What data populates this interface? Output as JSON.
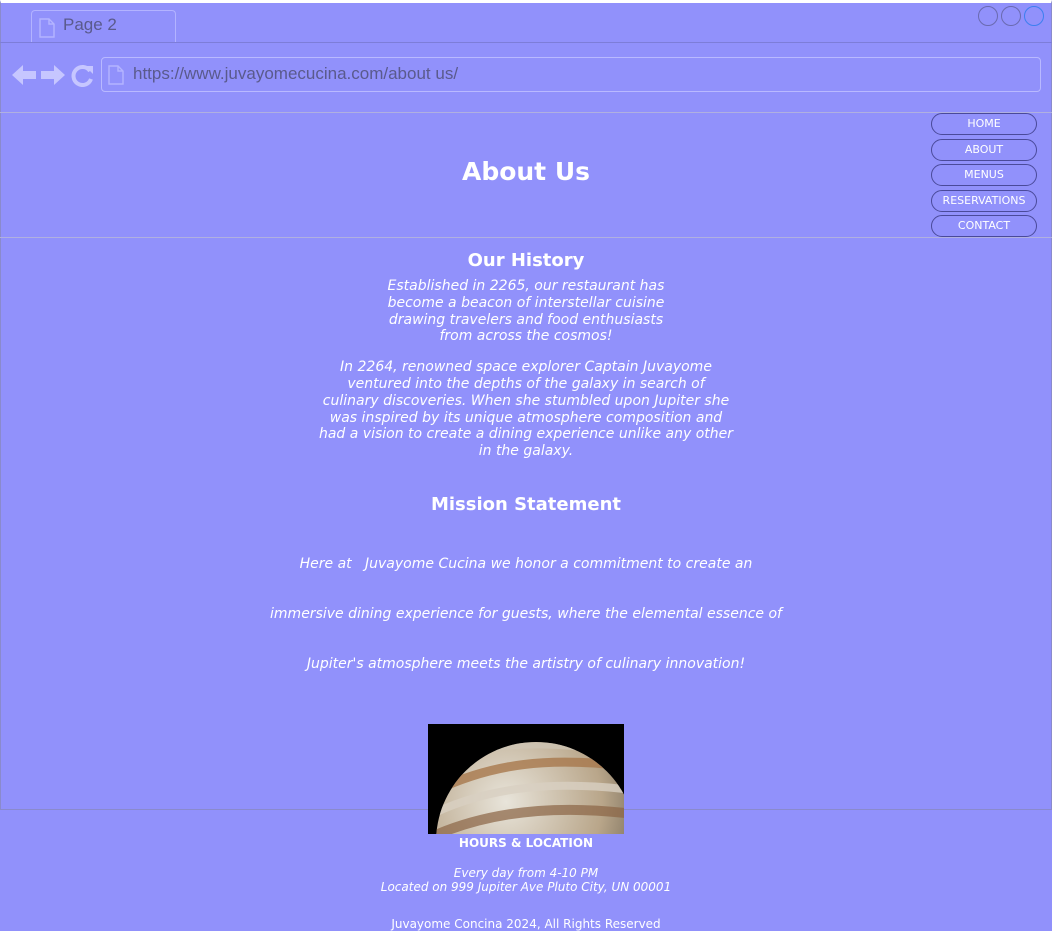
{
  "browser": {
    "tab_title": "Page 2",
    "url": "https://www.juvayomecucina.com/about us/"
  },
  "nav": {
    "items": [
      "HOME",
      "ABOUT",
      "MENUS",
      "RESERVATIONS",
      "CONTACT"
    ]
  },
  "page": {
    "title": "About Us",
    "history": {
      "heading": "Our History",
      "p1": [
        "Established in 2265, our restaurant has",
        "become a beacon of interstellar cuisine",
        "drawing travelers and food enthusiasts",
        "from across the cosmos!"
      ],
      "p2": [
        "In 2264, renowned space explorer Captain Juvayome",
        "ventured into the depths of the galaxy in search of",
        "culinary discoveries. When she stumbled upon Jupiter she",
        "was inspired by its unique atmosphere composition and",
        "had a vision to create a dining experience unlike any other",
        "in the galaxy."
      ]
    },
    "mission": {
      "heading": "Mission Statement",
      "lines": [
        "Here at   Juvayome Cucina we honor a commitment to create an",
        "immersive dining experience for guests, where the elemental essence of",
        "Jupiter's atmosphere meets the artistry of culinary innovation!"
      ]
    },
    "hours": {
      "heading": "HOURS & LOCATION",
      "when": "Every day from 4-10 PM",
      "where": "Located on 999 Jupiter Ave Pluto City, UN 00001"
    },
    "footer": "Juvayome Concina 2024, All Rights Reserved"
  },
  "colors": {
    "page_bg": "#9191fb",
    "text": "#ffffff",
    "chrome_text": "#5a5a8c"
  }
}
